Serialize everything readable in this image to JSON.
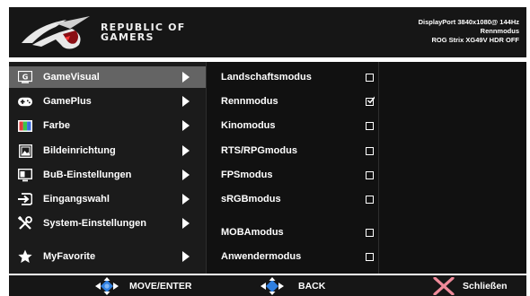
{
  "header": {
    "brand_line1": "REPUBLIC OF",
    "brand_line2": "GAMERS",
    "status_line1": "DisplayPort 3840x1080@ 144Hz",
    "status_line2": "Rennmodus",
    "status_line3": "ROG Strix XG49V HDR OFF"
  },
  "menu": {
    "items": [
      {
        "label": "GameVisual",
        "icon": "gamevisual-icon",
        "active": true
      },
      {
        "label": "GamePlus",
        "icon": "gamepad-icon"
      },
      {
        "label": "Farbe",
        "icon": "color-palette-icon"
      },
      {
        "label": "Bildeinrichtung",
        "icon": "image-icon"
      },
      {
        "label": "BuB-Einstellungen",
        "icon": "pip-icon"
      },
      {
        "label": "Eingangswahl",
        "icon": "input-icon"
      },
      {
        "label": "System-Einstellungen",
        "icon": "tools-icon"
      },
      {
        "label": "MyFavorite",
        "icon": "star-icon"
      }
    ]
  },
  "submenu": {
    "items": [
      {
        "label": "Landschaftsmodus",
        "checked": false
      },
      {
        "label": "Rennmodus",
        "checked": true
      },
      {
        "label": "Kinomodus",
        "checked": false
      },
      {
        "label": "RTS/RPGmodus",
        "checked": false
      },
      {
        "label": "FPSmodus",
        "checked": false
      },
      {
        "label": "sRGBmodus",
        "checked": false
      },
      {
        "label": "MOBAmodus",
        "checked": false
      },
      {
        "label": "Anwendermodus",
        "checked": false
      }
    ]
  },
  "footer": {
    "move_label": "MOVE/ENTER",
    "back_label": "BACK",
    "close_label": "Schließen"
  },
  "colors": {
    "accent_blue": "#2f7fe0",
    "close_pink": "#f08a9a",
    "active_bg": "#646464"
  }
}
